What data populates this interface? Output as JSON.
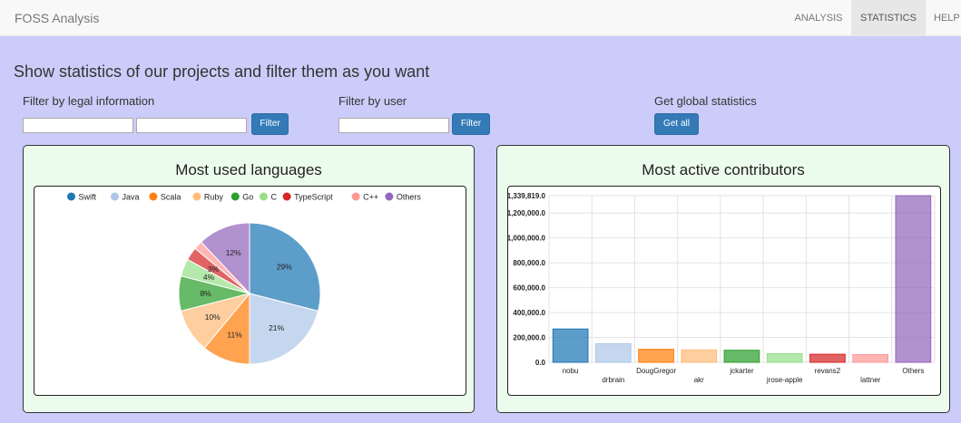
{
  "navbar": {
    "brand": "FOSS Analysis",
    "items": [
      {
        "label": "ANALYSIS",
        "active": false
      },
      {
        "label": "STATISTICS",
        "active": true
      },
      {
        "label": "HELP",
        "active": false
      }
    ]
  },
  "main": {
    "headline": "Show statistics of our projects and filter them as you want",
    "legal_filter": {
      "label": "Filter by legal information",
      "input1_value": "",
      "input2_value": "",
      "button": "Filter"
    },
    "user_filter": {
      "label": "Filter by user",
      "input_value": "",
      "button": "Filter"
    },
    "global": {
      "label": "Get global statistics",
      "button": "Get all"
    }
  },
  "languages_panel": {
    "title": "Most used languages"
  },
  "contributors_panel": {
    "title": "Most active contributors"
  },
  "chart_data": [
    {
      "type": "pie",
      "title": "Most used languages",
      "legend_position": "top",
      "labels": [
        "Swift",
        "Java",
        "Scala",
        "Ruby",
        "Go",
        "C",
        "TypeScript",
        "C++",
        "Others"
      ],
      "values": [
        29,
        21,
        11,
        10,
        8,
        4,
        3,
        2,
        12
      ],
      "value_labels": [
        "29%",
        "21%",
        "11%",
        "10%",
        "8%",
        "4%",
        "3%",
        "",
        "12%"
      ],
      "colors": [
        "#1f77b4",
        "#aec7e8",
        "#ff7f0e",
        "#ffbb78",
        "#2ca02c",
        "#98df8a",
        "#d62728",
        "#ff9896",
        "#9467bd"
      ]
    },
    {
      "type": "bar",
      "title": "Most active contributors",
      "categories": [
        "nobu",
        "drbrain",
        "DougGregor",
        "akr",
        "jckarter",
        "jrose-apple",
        "revans2",
        "lattner",
        "Others"
      ],
      "values": [
        268000,
        150000,
        105000,
        100000,
        97000,
        70000,
        65000,
        62000,
        1339819
      ],
      "ylim": [
        0,
        1339819
      ],
      "yticks": [
        {
          "value": 0,
          "label": "0.0"
        },
        {
          "value": 200000,
          "label": "200,000.0"
        },
        {
          "value": 400000,
          "label": "400,000.0"
        },
        {
          "value": 600000,
          "label": "600,000.0"
        },
        {
          "value": 800000,
          "label": "800,000.0"
        },
        {
          "value": 1000000,
          "label": "1,000,000.0"
        },
        {
          "value": 1200000,
          "label": "1,200,000.0"
        },
        {
          "value": 1339819,
          "label": "1,339,819.0"
        }
      ],
      "grid": true,
      "colors": [
        "#1f77b4",
        "#aec7e8",
        "#ff7f0e",
        "#ffbb78",
        "#2ca02c",
        "#98df8a",
        "#d62728",
        "#ff9896",
        "#9467bd"
      ]
    }
  ]
}
